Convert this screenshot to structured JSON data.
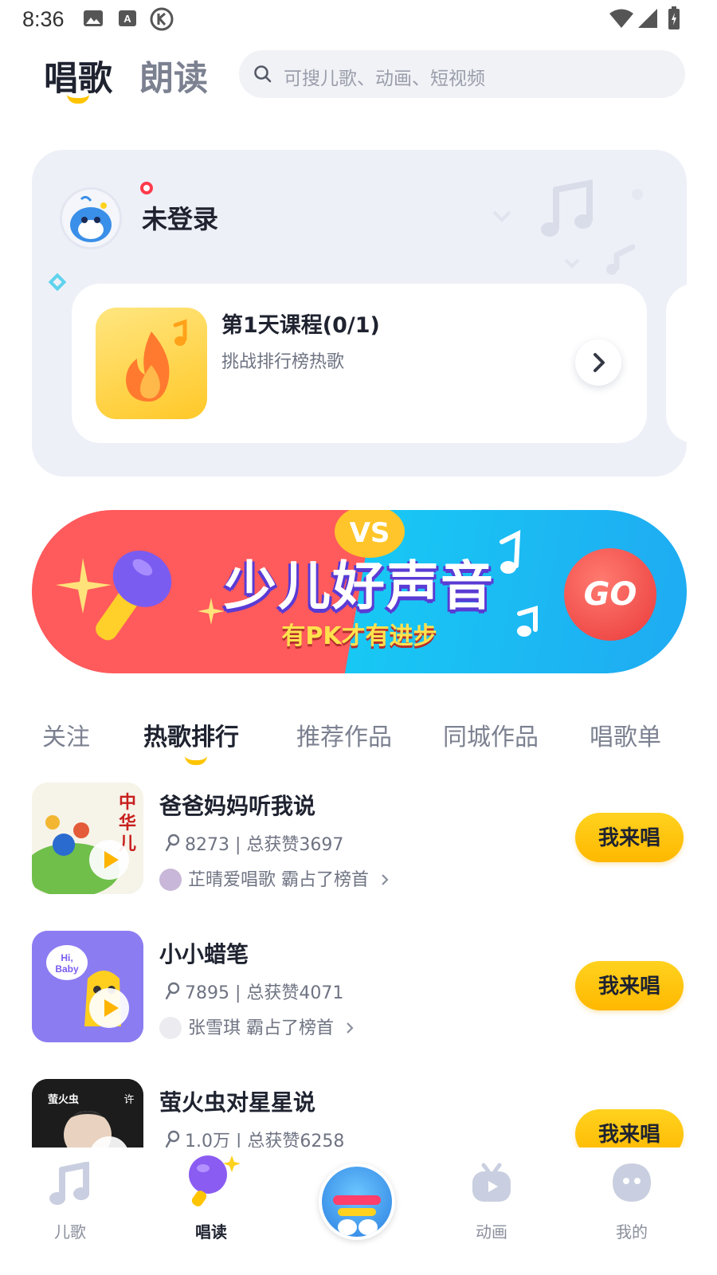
{
  "status_bar": {
    "time": "8:36"
  },
  "header": {
    "tabs": [
      {
        "label": "唱歌",
        "active": true
      },
      {
        "label": "朗读",
        "active": false
      }
    ],
    "search_placeholder": "可搜儿歌、动画、短视频"
  },
  "user_card": {
    "username": "未登录",
    "course": {
      "title": "第1天课程(0/1)",
      "subtitle": "挑战排行榜热歌"
    }
  },
  "banner": {
    "badge": "VS",
    "title": "少儿好声音",
    "subtitle": "有PK才有进步",
    "go_label": "GO"
  },
  "content_tabs": [
    {
      "label": "关注",
      "active": false
    },
    {
      "label": "热歌排行",
      "active": true
    },
    {
      "label": "推荐作品",
      "active": false
    },
    {
      "label": "同城作品",
      "active": false
    },
    {
      "label": "唱歌单",
      "active": false
    }
  ],
  "songs": [
    {
      "title": "爸爸妈妈听我说",
      "stats": "8273 | 总获赞3697",
      "top_singer": "芷晴爱唱歌 霸占了榜首",
      "action": "我来唱"
    },
    {
      "title": "小小蜡笔",
      "stats": "7895 | 总获赞4071",
      "top_singer": "张雪琪 霸占了榜首",
      "action": "我来唱"
    },
    {
      "title": "萤火虫对星星说",
      "stats": "1.0万 | 总获赞6258",
      "top_singer": "",
      "action": "我来唱"
    }
  ],
  "bottom_nav": [
    {
      "label": "儿歌",
      "icon": "music-note-icon",
      "active": false
    },
    {
      "label": "唱读",
      "icon": "microphone-icon",
      "active": true
    },
    {
      "label": "",
      "icon": "app-logo-icon",
      "active": false
    },
    {
      "label": "动画",
      "icon": "tv-icon",
      "active": false
    },
    {
      "label": "我的",
      "icon": "profile-face-icon",
      "active": false
    }
  ],
  "colors": {
    "accent_yellow": "#ffc400",
    "banner_red": "#ff5a5c",
    "banner_blue": "#18c8f4",
    "card_bg": "#eef0f8"
  }
}
